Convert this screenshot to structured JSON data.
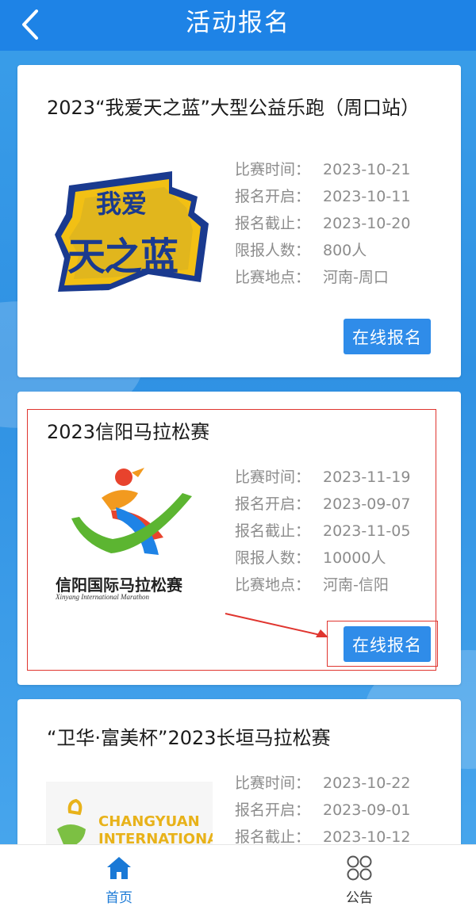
{
  "header": {
    "title": "活动报名"
  },
  "events": [
    {
      "title": "2023“我爱天之蓝”大型公益乐跑（周口站）",
      "logo_text_top": "我爱",
      "logo_text_main": "天之蓝",
      "fields": [
        {
          "label": "比赛时间：",
          "value": "2023-10-21"
        },
        {
          "label": "报名开启：",
          "value": "2023-10-11"
        },
        {
          "label": "报名截止：",
          "value": "2023-10-20"
        },
        {
          "label": "限报人数：",
          "value": "800人"
        },
        {
          "label": "比赛地点：",
          "value": "河南-周口"
        }
      ],
      "button": "在线报名"
    },
    {
      "title": "2023信阳马拉松赛",
      "logo_text_cn": "信阳国际马拉松赛",
      "logo_text_en": "Xinyang International Marathon",
      "fields": [
        {
          "label": "比赛时间：",
          "value": "2023-11-19"
        },
        {
          "label": "报名开启：",
          "value": "2023-09-07"
        },
        {
          "label": "报名截止：",
          "value": "2023-11-05"
        },
        {
          "label": "限报人数：",
          "value": "10000人"
        },
        {
          "label": "比赛地点：",
          "value": "河南-信阳"
        }
      ],
      "button": "在线报名"
    },
    {
      "title": "“卫华·富美杯”2023长垣马拉松赛",
      "logo_text_1": "CHANGYUAN",
      "logo_text_2": "INTERNATIONAL",
      "fields": [
        {
          "label": "比赛时间：",
          "value": "2023-10-22"
        },
        {
          "label": "报名开启：",
          "value": "2023-09-01"
        },
        {
          "label": "报名截止：",
          "value": "2023-10-12"
        }
      ]
    }
  ],
  "bottom_nav": {
    "home": {
      "label": "首页",
      "icon": "home-icon",
      "active_color": "#1a79d6"
    },
    "notice": {
      "label": "公告",
      "icon": "grid-icon",
      "color": "#333333"
    }
  },
  "colors": {
    "header": "#1e83e6",
    "button": "#2f8ce9",
    "highlight": "#e0352f"
  }
}
